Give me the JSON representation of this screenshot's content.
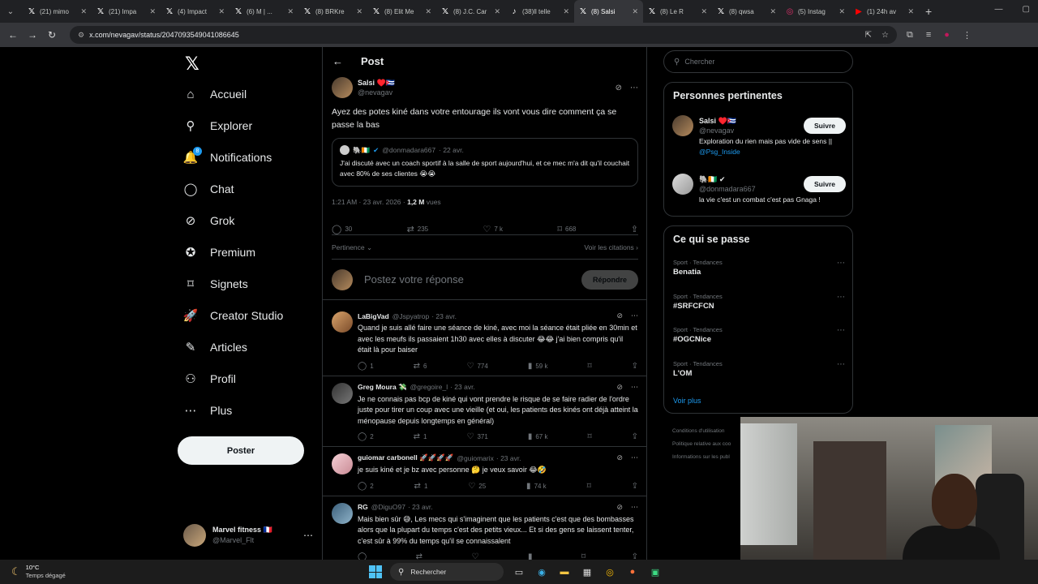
{
  "browser": {
    "tabs": [
      {
        "label": "(21) mimo",
        "icon": "x-logo-icon"
      },
      {
        "label": "(21) Impa",
        "icon": "x-logo-icon"
      },
      {
        "label": "(4) Impact",
        "icon": "x-logo-icon"
      },
      {
        "label": "(6) M | ...",
        "icon": "x-logo-icon"
      },
      {
        "label": "(8) BRKre",
        "icon": "x-logo-icon"
      },
      {
        "label": "(8) Elit Me",
        "icon": "x-logo-icon"
      },
      {
        "label": "(8) J.C. Car",
        "icon": "x-logo-icon"
      },
      {
        "label": "(38)ll telle",
        "icon": "tiktok-icon"
      },
      {
        "label": "(8) Salsi",
        "icon": "x-logo-icon",
        "active": true
      },
      {
        "label": "(8) Le R",
        "icon": "x-logo-icon"
      },
      {
        "label": "(8) qwsa",
        "icon": "x-logo-icon"
      },
      {
        "label": "(5) Instag",
        "icon": "instagram-icon"
      },
      {
        "label": "(1) 24h av",
        "icon": "youtube-icon"
      }
    ],
    "url": "x.com/nevagav/status/2047093549041086645"
  },
  "nav": {
    "logo": "𝕏",
    "items": [
      {
        "label": "Accueil",
        "icon": "home-icon",
        "glyph": "⌂"
      },
      {
        "label": "Explorer",
        "icon": "search-icon",
        "glyph": "⚲"
      },
      {
        "label": "Notifications",
        "icon": "bell-icon",
        "glyph": "🔔",
        "badge": "8"
      },
      {
        "label": "Chat",
        "icon": "chat-icon",
        "glyph": "◯"
      },
      {
        "label": "Grok",
        "icon": "grok-icon",
        "glyph": "⊘"
      },
      {
        "label": "Premium",
        "icon": "premium-icon",
        "glyph": "✪"
      },
      {
        "label": "Signets",
        "icon": "bookmark-icon",
        "glyph": "⌑"
      },
      {
        "label": "Creator Studio",
        "icon": "rocket-icon",
        "glyph": "🚀"
      },
      {
        "label": "Articles",
        "icon": "article-icon",
        "glyph": "✎"
      },
      {
        "label": "Profil",
        "icon": "profile-icon",
        "glyph": "⚇"
      },
      {
        "label": "Plus",
        "icon": "more-icon",
        "glyph": "⋯"
      }
    ],
    "post_button": "Poster",
    "account": {
      "name": "Marvel fitness 🇫🇷",
      "handle": "@Marvel_Flt"
    }
  },
  "main": {
    "header_title": "Post",
    "tweet": {
      "name": "Salsi ♥️🇨🇺",
      "handle": "@nevagav",
      "text": "Ayez des potes kiné dans votre entourage ils vont vous dire comment ça se passe la bas",
      "quote": {
        "name": "🐘🇨🇮",
        "handle": "@donmadara667",
        "date": "· 22 avr.",
        "text": "J'ai discuté avec un coach sportif à la salle de sport aujourd'hui, et ce mec m'a dit qu'il couchait avec 80% de ses clientes 😭😭"
      },
      "time": "1:21 AM · 23 avr. 2026 · ",
      "views": "1,2 M",
      "views_label": " vues",
      "stats": {
        "replies": "30",
        "retweets": "235",
        "likes": "7 k",
        "bookmarks": "668"
      },
      "sort_label": "Pertinence ⌄",
      "citations_label": "Voir les citations ›"
    },
    "reply_placeholder": "Postez votre réponse",
    "reply_button": "Répondre",
    "replies": [
      {
        "name": "LaBigVad",
        "handle": "@Jspyatrop",
        "date": "· 23 avr.",
        "text": "Quand je suis allé faire une séance de kiné, avec moi la séance était pliée en 30min et avec les meufs ils passaient 1h30 avec elles à discuter 😂😂 j'ai bien compris qu'il était là pour baiser",
        "replies": "1",
        "retweets": "6",
        "likes": "774",
        "views": "59 k"
      },
      {
        "name": "Greg Moura 💸",
        "handle": "@gregoire_l",
        "date": "· 23 avr.",
        "text": "Je ne connais pas bcp de kiné qui vont prendre le risque de se faire radier de l'ordre juste pour tirer un coup avec une vieille (et oui, les patients des kinés ont déjà atteint la ménopause depuis longtemps en général)",
        "replies": "2",
        "retweets": "1",
        "likes": "371",
        "views": "67 k"
      },
      {
        "name": "guiomar carbonell 🚀🚀🚀🚀",
        "handle": "@guiomarix",
        "date": "· 23 avr.",
        "text": "je suis kiné et je bz avec personne 🤔 je veux savoir 😂🤣",
        "replies": "2",
        "retweets": "1",
        "likes": "25",
        "views": "74 k"
      },
      {
        "name": "RG",
        "handle": "@DiguO97",
        "date": "· 23 avr.",
        "text": "Mais bien sûr 😅, Les mecs qui s'imaginent que les patients c'est que des bombasses alors que la plupart du temps c'est des petits vieux... Et si des gens se laissent tenter, c'est sûr à 99% du temps qu'il se connaissalent",
        "replies": "",
        "retweets": "",
        "likes": "",
        "views": ""
      }
    ]
  },
  "right": {
    "search_placeholder": "Chercher",
    "people_title": "Personnes pertinentes",
    "people": [
      {
        "name": "Salsi ♥️🇨🇺",
        "handle": "@nevagav",
        "button": "Suivre",
        "bio": "Exploration du rien mais pas vide de sens || ",
        "bio_link": "@Psg_Inside"
      },
      {
        "name": "🐘🇨🇮 ✔",
        "handle": "@donmadara667",
        "button": "Suivre",
        "bio": "la vie c'est un combat c'est pas Gnaga !",
        "bio_link": ""
      }
    ],
    "trends_title": "Ce qui se passe",
    "trends": [
      {
        "category": "Sport · Tendances",
        "name": "Benatia"
      },
      {
        "category": "Sport · Tendances",
        "name": "#SRFCFCN"
      },
      {
        "category": "Sport · Tendances",
        "name": "#OGCNice"
      },
      {
        "category": "Sport · Tendances",
        "name": "L'OM"
      }
    ],
    "see_more": "Voir plus",
    "footer": [
      "Conditions d'utilisation",
      "Politique relative aux coo",
      "Informations sur les publ"
    ]
  },
  "taskbar": {
    "temp": "10°C",
    "weather": "Temps dégagé",
    "search": "Rechercher"
  }
}
